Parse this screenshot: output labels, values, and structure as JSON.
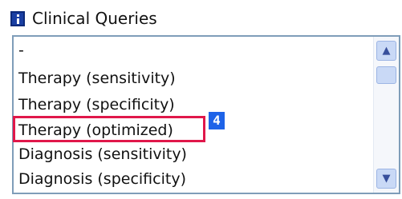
{
  "window": {
    "title": "Clinical Queries",
    "title_icon": "info-icon"
  },
  "list": {
    "items": [
      {
        "label": "-"
      },
      {
        "label": "Therapy (sensitivity)"
      },
      {
        "label": "Therapy (specificity)"
      },
      {
        "label": "Therapy (optimized)",
        "highlighted": true
      },
      {
        "label": "Diagnosis (sensitivity)"
      },
      {
        "label": "Diagnosis (specificity)"
      }
    ],
    "highlight_color": "#e0174a",
    "badge_label": "4",
    "badge_color": "#1e63e8"
  },
  "scrollbar": {
    "up_icon": "chevron-up-icon",
    "down_icon": "chevron-down-icon",
    "up_glyph": "▲",
    "down_glyph": "▼"
  }
}
